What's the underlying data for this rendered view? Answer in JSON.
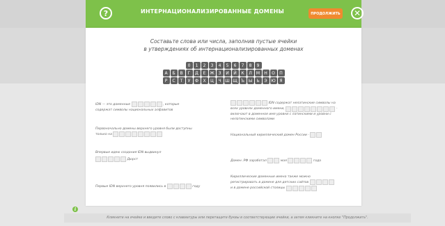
{
  "header": {
    "title": "ИНТЕРНАЦИОНАЛИЗИРОВАННЫЕ ДОМЕНЫ",
    "continue_label": "ПРОДОЛЖИТЬ",
    "help_glyph": "?",
    "close_glyph": "✕",
    "colors": {
      "header_bg": "#7ec14a",
      "continue_bg": "#f08a2f"
    }
  },
  "instructions": {
    "line1": "Составьте слова или числа, заполнив пустые ячейки",
    "line2": "в утверждениях об интернационализированных доменах"
  },
  "tiles": {
    "digits": [
      "0",
      "1",
      "2",
      "3",
      "4",
      "5",
      "6",
      "7",
      "8",
      "9"
    ],
    "row2": [
      "А",
      "Б",
      "В",
      "Г",
      "Д",
      "Е",
      "Ж",
      "З",
      "И",
      "Й",
      "К",
      "Л",
      "М",
      "Н",
      "О",
      "П"
    ],
    "row3": [
      "Р",
      "С",
      "Т",
      "У",
      "Ф",
      "Х",
      "Ц",
      "Ч",
      "Ш",
      "Щ",
      "Ъ",
      "Ы",
      "Ь",
      "Э",
      "Ю",
      "Я"
    ]
  },
  "statements": {
    "s1_a": "IDN — это доменные",
    "s1_b": ", которые",
    "s1_c": "содержат символы национальных алфавитов",
    "s2_a": "IDN содержат нелатинские символы на",
    "s2_b": "всех уровнях доменного имени,",
    "s2_c": "-",
    "s2_d": "включают в доменное имя уровни с латинскими и уровни с",
    "s2_e": "нелатинскими символами",
    "s3_a": "Первоначально домены верхнего уровня были доступны",
    "s3_b": "только на",
    "s4_a": "Национальный кириллический домен России -",
    "s5_a": "Впервые идею создания IDN выдвинул",
    "s5_b": "Дюрст",
    "s6_a": "Домен .РФ заработал",
    "s6_b": "мая",
    "s6_c": "года",
    "s7_a": "Первые IDN верхнего уровня появились в",
    "s7_b": "году",
    "s8_a": "Кириллические доменные имена также можно",
    "s8_b": "регистрировать в домене для детских сайтов",
    "s8_c": "и в домене российской столицы"
  },
  "footer": {
    "text": "Кликните на ячейке и введите слово с клавиатуры или перетащите буквы в соответствующие ячейки, а затем кликните на кнопке \"Продолжить\".",
    "info_glyph": "i"
  }
}
